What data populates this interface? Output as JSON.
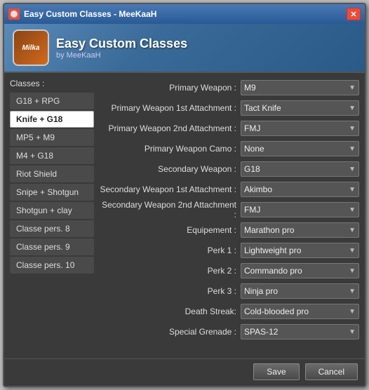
{
  "window": {
    "title": "Easy Custom Classes - MeeKaaH",
    "close_label": "✕"
  },
  "header": {
    "logo_text": "Milka",
    "app_title": "Easy Custom Classes",
    "app_subtitle": "by MeeKaaH"
  },
  "classes_label": "Classes :",
  "classes": [
    {
      "id": "c1",
      "label": "G18 + RPG",
      "selected": false
    },
    {
      "id": "c2",
      "label": "Knife + G18",
      "selected": true
    },
    {
      "id": "c3",
      "label": "MP5 + M9",
      "selected": false
    },
    {
      "id": "c4",
      "label": "M4 + G18",
      "selected": false
    },
    {
      "id": "c5",
      "label": "Riot Shield",
      "selected": false
    },
    {
      "id": "c6",
      "label": "Snipe + Shotgun",
      "selected": false
    },
    {
      "id": "c7",
      "label": "Shotgun + clay",
      "selected": false
    },
    {
      "id": "c8",
      "label": "Classe pers. 8",
      "selected": false
    },
    {
      "id": "c9",
      "label": "Classe pers. 9",
      "selected": false
    },
    {
      "id": "c10",
      "label": "Classe pers. 10",
      "selected": false
    }
  ],
  "fields": [
    {
      "label": "Primary Weapon :",
      "value": "M9"
    },
    {
      "label": "Primary Weapon 1st Attachment :",
      "value": "Tact Knife"
    },
    {
      "label": "Primary Weapon 2nd Attachment :",
      "value": "FMJ"
    },
    {
      "label": "Primary Weapon Camo :",
      "value": "None"
    },
    {
      "label": "Secondary Weapon :",
      "value": "G18"
    },
    {
      "label": "Secondary Weapon 1st Attachment :",
      "value": "Akimbo"
    },
    {
      "label": "Secondary Weapon 2nd Attachment :",
      "value": "FMJ"
    },
    {
      "label": "Equipement :",
      "value": "Marathon pro"
    },
    {
      "label": "Perk 1 :",
      "value": "Lightweight pro"
    },
    {
      "label": "Perk 2 :",
      "value": "Commando pro"
    },
    {
      "label": "Perk 3 :",
      "value": "Ninja pro"
    },
    {
      "label": "Death Streak:",
      "value": "Cold-blooded pro"
    },
    {
      "label": "Special Grenade :",
      "value": "SPAS-12"
    }
  ],
  "buttons": {
    "save": "Save",
    "cancel": "Cancel"
  }
}
